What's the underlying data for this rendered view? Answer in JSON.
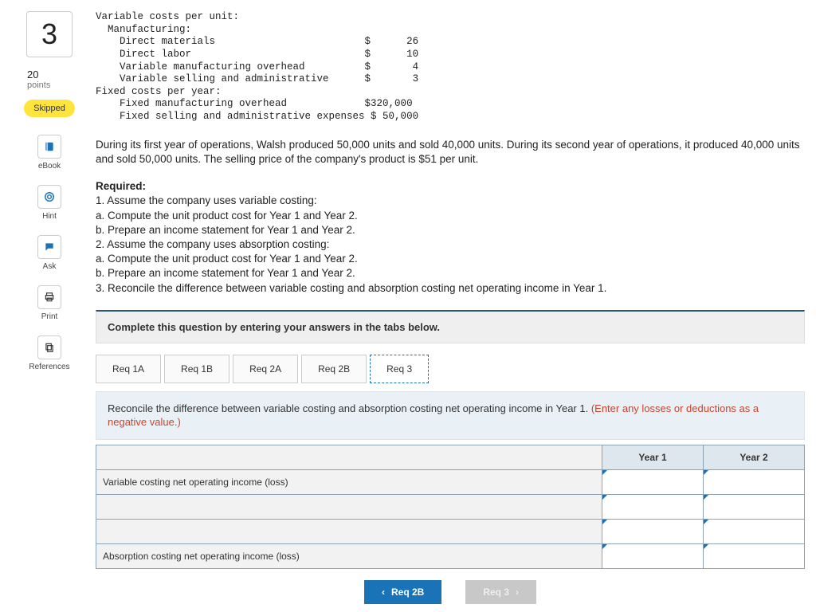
{
  "question": {
    "number": "3",
    "points_value": "20",
    "points_label": "points",
    "status_badge": "Skipped"
  },
  "tools": {
    "ebook": "eBook",
    "hint": "Hint",
    "ask": "Ask",
    "print": "Print",
    "references": "References"
  },
  "costs_block": "Variable costs per unit:\n  Manufacturing:\n    Direct materials                         $      26\n    Direct labor                             $      10\n    Variable manufacturing overhead          $       4\n    Variable selling and administrative      $       3\nFixed costs per year:\n    Fixed manufacturing overhead             $320,000\n    Fixed selling and administrative expenses $ 50,000",
  "context_paragraph": "During its first year of operations, Walsh produced 50,000 units and sold 40,000 units. During its second year of operations, it produced 40,000 units and sold 50,000 units. The selling price of the company's product is $51 per unit.",
  "required": {
    "title": "Required:",
    "lines": [
      "1. Assume the company uses variable costing:",
      "a. Compute the unit product cost for Year 1 and Year 2.",
      "b. Prepare an income statement for Year 1 and Year 2.",
      "2. Assume the company uses absorption costing:",
      "a. Compute the unit product cost for Year 1 and Year 2.",
      "b. Prepare an income statement for Year 1 and Year 2.",
      "3. Reconcile the difference between variable costing and absorption costing net operating income in Year 1."
    ]
  },
  "instruction_bar": "Complete this question by entering your answers in the tabs below.",
  "tabs": [
    {
      "label": "Req 1A"
    },
    {
      "label": "Req 1B"
    },
    {
      "label": "Req 2A"
    },
    {
      "label": "Req 2B"
    },
    {
      "label": "Req 3",
      "active": true
    }
  ],
  "tab_prompt": {
    "main": "Reconcile the difference between variable costing and absorption costing net operating income in Year 1. ",
    "hint": "(Enter any losses or deductions as a negative value.)"
  },
  "answer_table": {
    "headers": [
      "Year 1",
      "Year 2"
    ],
    "rows": [
      "Variable costing net operating income (loss)",
      "",
      "",
      "Absorption costing net operating income (loss)"
    ]
  },
  "nav": {
    "prev": "Req 2B",
    "next": "Req 3"
  }
}
